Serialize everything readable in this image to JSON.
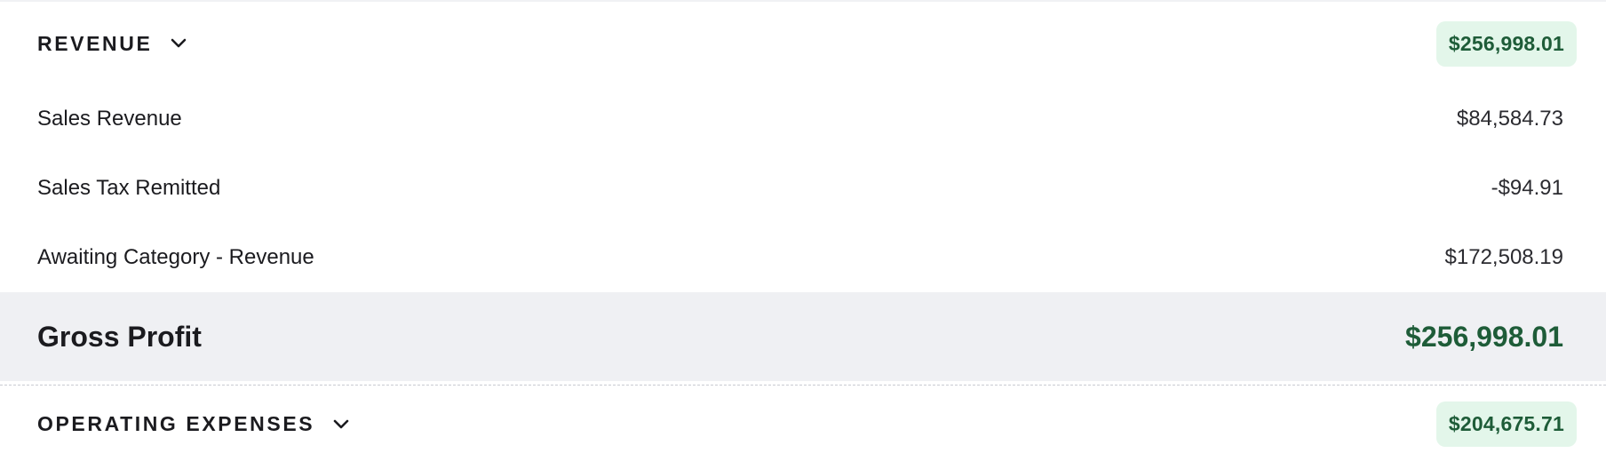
{
  "revenue": {
    "title": "REVENUE",
    "toggle_icon": "chevron-down-icon",
    "total": "$256,998.01",
    "items": [
      {
        "label": "Sales Revenue",
        "value": "$84,584.73"
      },
      {
        "label": "Sales Tax Remitted",
        "value": "-$94.91"
      },
      {
        "label": "Awaiting Category - Revenue",
        "value": "$172,508.19"
      }
    ]
  },
  "gross_profit": {
    "label": "Gross Profit",
    "value": "$256,998.01"
  },
  "operating_expenses": {
    "title": "OPERATING EXPENSES",
    "toggle_icon": "chevron-down-icon",
    "total": "$204,675.71"
  },
  "colors": {
    "badge_bg": "#e3f6ea",
    "positive_green": "#1e5c38",
    "highlight_row_bg": "#eff0f3",
    "text_primary": "#1b1b1f"
  }
}
